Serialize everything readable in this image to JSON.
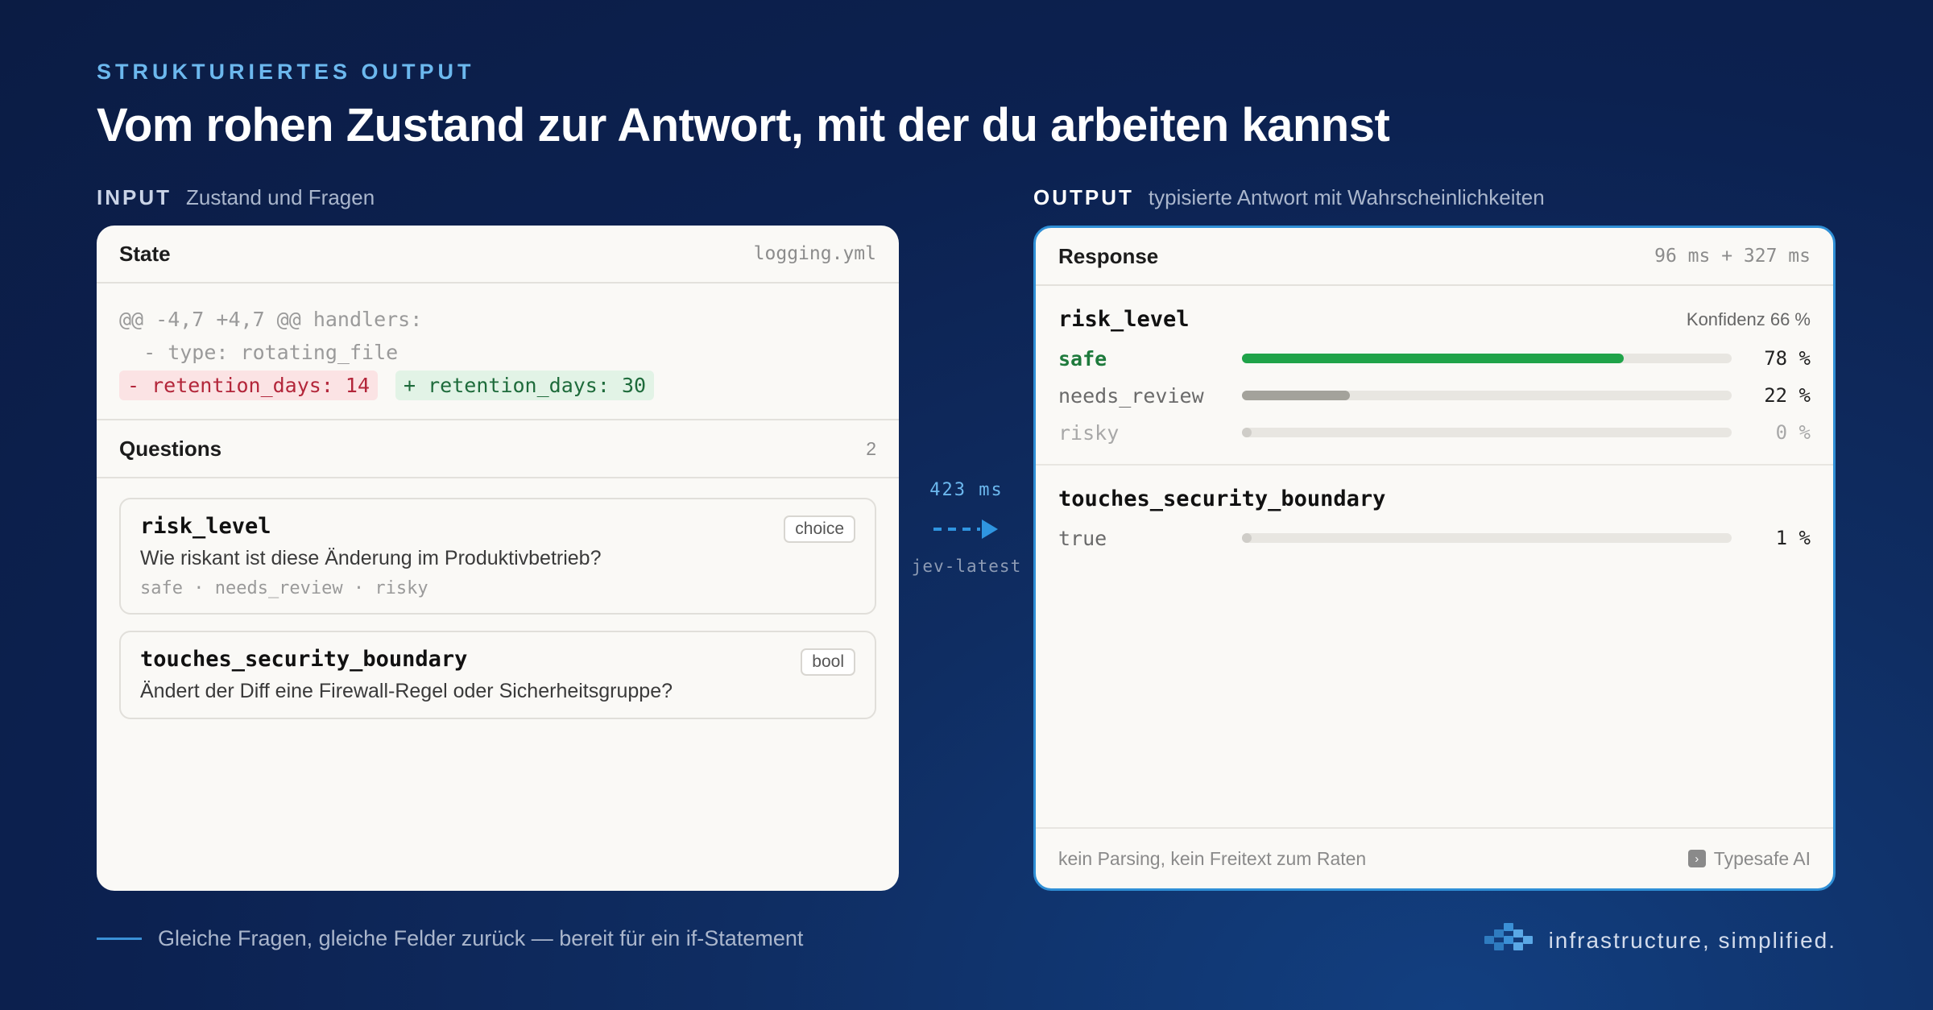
{
  "header": {
    "eyebrow": "STRUKTURIERTES OUTPUT",
    "title": "Vom rohen Zustand zur Antwort, mit der du arbeiten kannst"
  },
  "input_label": {
    "key": "INPUT",
    "desc": "Zustand und Fragen"
  },
  "output_label": {
    "key": "OUTPUT",
    "desc": "typisierte Antwort mit Wahrscheinlichkeiten"
  },
  "state": {
    "title": "State",
    "file": "logging.yml",
    "lines": [
      "@@ -4,7 +4,7 @@ handlers:",
      "  - type: rotating_file"
    ],
    "removed": "- retention_days: 14",
    "added": "+ retention_days: 30"
  },
  "questions": {
    "title": "Questions",
    "count": "2",
    "items": [
      {
        "name": "risk_level",
        "text": "Wie riskant ist diese Änderung im Produktivbetrieb?",
        "options": "safe · needs_review · risky",
        "tag": "choice"
      },
      {
        "name": "touches_security_boundary",
        "text": "Ändert der Diff eine Firewall-Regel oder Sicherheitsgruppe?",
        "options": "",
        "tag": "bool"
      }
    ]
  },
  "flow": {
    "latency": "423 ms",
    "model": "jev-latest",
    "accent": "#2f95e0"
  },
  "response": {
    "title": "Response",
    "timing": "96 ms + 327 ms",
    "risk": {
      "name": "risk_level",
      "confidence": "Konfidenz 66 %",
      "rows": [
        {
          "label": "safe",
          "value": 78,
          "pct": "78 %",
          "color": "#1fa349"
        },
        {
          "label": "needs_review",
          "value": 22,
          "pct": "22 %",
          "color": "#a3a29b"
        },
        {
          "label": "risky",
          "value": 0,
          "pct": "0 %",
          "color": "#cfcdc8"
        }
      ]
    },
    "security": {
      "name": "touches_security_boundary",
      "rows": [
        {
          "label": "true",
          "value": 1,
          "pct": "1 %",
          "color": "#cfcdc8"
        }
      ]
    },
    "footer_note": "kein Parsing, kein Freitext zum Raten",
    "brand": "Typesafe AI"
  },
  "footer": {
    "left": "Gleiche Fragen, gleiche Felder zurück — bereit für ein if-Statement",
    "right": "infrastructure, simplified."
  }
}
